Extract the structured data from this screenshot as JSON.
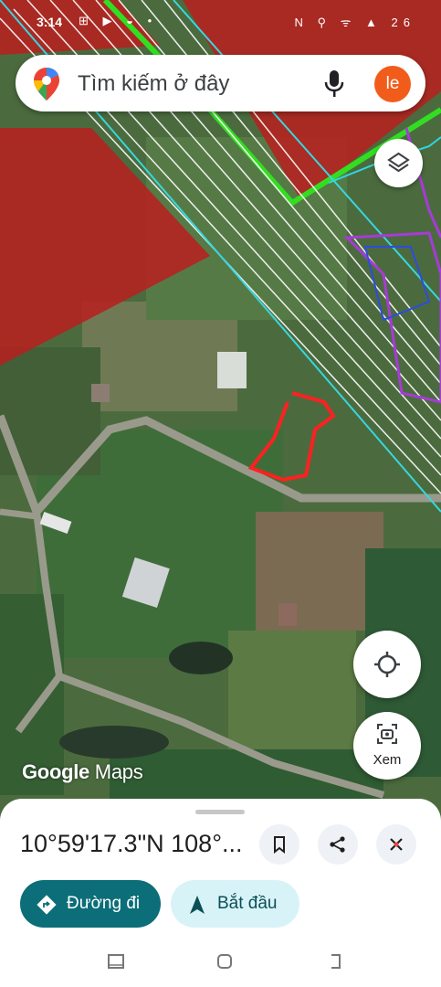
{
  "status_bar": {
    "time": "3:14",
    "left_icons": "⊞ ▶ ◒ •",
    "right_icons": "N ⚲ ᯤ ▲ 26"
  },
  "search": {
    "placeholder": "Tìm kiếm ở đây",
    "avatar_text": "le"
  },
  "map": {
    "watermark_google": "Google",
    "watermark_maps": "Maps",
    "see_label": "Xem"
  },
  "sheet": {
    "coordinates": "10°59'17.3\"N 108°...",
    "directions_label": "Đường đi",
    "start_label": "Bắt đầu"
  },
  "colors": {
    "brand_teal": "#0b6e78",
    "start_bg": "#d8f3f8",
    "avatar": "#f25c1b",
    "parcel_red": "#b81f1f",
    "boundary_green": "#33dd22"
  },
  "icons": [
    "maps-pin-icon",
    "microphone-icon",
    "layers-icon",
    "my-location-icon",
    "camera-scan-icon",
    "bookmark-icon",
    "share-icon",
    "close-icon",
    "directions-icon",
    "navigation-arrow-icon"
  ]
}
